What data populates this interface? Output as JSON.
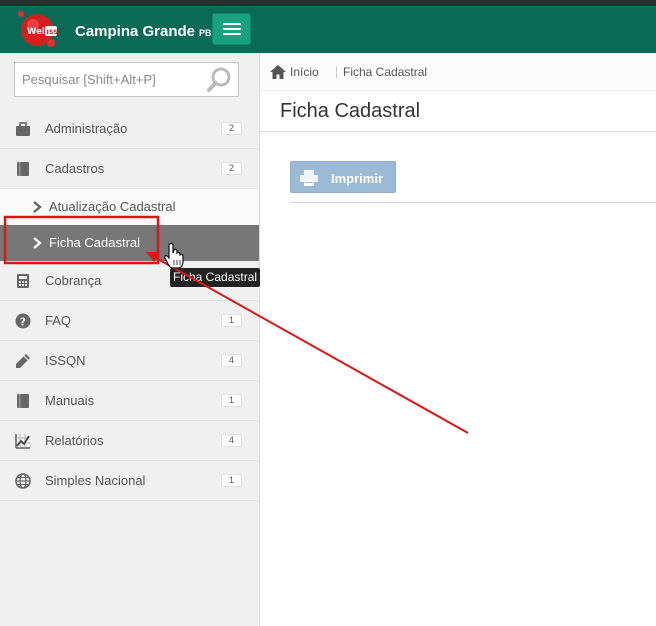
{
  "header": {
    "logo_text": "Well ISS",
    "city": "Campina Grande",
    "state": "PB",
    "menu_icon": "hamburger-icon"
  },
  "search": {
    "placeholder": "Pesquisar [Shift+Alt+P]",
    "value": "",
    "icon": "search-icon"
  },
  "sidebar": {
    "items": [
      {
        "label": "Administração",
        "badge": "2",
        "icon": "briefcase-icon"
      },
      {
        "label": "Cadastros",
        "badge": "2",
        "icon": "book-icon",
        "children": [
          {
            "label": "Atualização Cadastral",
            "active": false
          },
          {
            "label": "Ficha Cadastral",
            "active": true
          }
        ]
      },
      {
        "label": "Cobrança",
        "badge": "",
        "icon": "calculator-icon"
      },
      {
        "label": "FAQ",
        "badge": "1",
        "icon": "question-icon"
      },
      {
        "label": "ISSQN",
        "badge": "4",
        "icon": "pencil-icon"
      },
      {
        "label": "Manuais",
        "badge": "1",
        "icon": "book-icon"
      },
      {
        "label": "Relatórios",
        "badge": "4",
        "icon": "chart-icon"
      },
      {
        "label": "Simples Nacional",
        "badge": "1",
        "icon": "globe-icon"
      }
    ]
  },
  "breadcrumb": {
    "home": "Início",
    "current": "Ficha Cadastral"
  },
  "main": {
    "title": "Ficha Cadastral",
    "print_label": "Imprimir"
  },
  "tooltip": {
    "text": "Ficha Cadastral"
  },
  "colors": {
    "header_bg": "#0b6a55",
    "toggle_bg": "#17a37f",
    "active_item_bg": "#777777",
    "print_button_bg": "#9bbad6",
    "annotation_red": "#e01515"
  }
}
